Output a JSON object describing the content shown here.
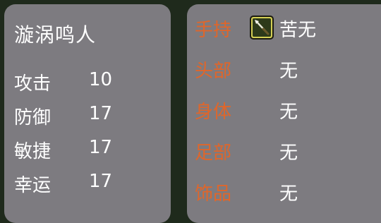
{
  "character": {
    "name": "漩涡鸣人",
    "stats": [
      {
        "label": "攻击",
        "value": "10"
      },
      {
        "label": "防御",
        "value": "17"
      },
      {
        "label": "敏捷",
        "value": "17"
      },
      {
        "label": "幸运",
        "value": "17"
      }
    ]
  },
  "equipment": {
    "slots": [
      {
        "label": "手持",
        "value": "苦无",
        "icon": "kunai-icon"
      },
      {
        "label": "头部",
        "value": "无"
      },
      {
        "label": "身体",
        "value": "无"
      },
      {
        "label": "足部",
        "value": "无"
      },
      {
        "label": "饰品",
        "value": "无"
      }
    ]
  },
  "colors": {
    "background": "#1f2a1c",
    "panel": "#7d7b80",
    "slot_label": "#e0662a",
    "text": "#ffffff",
    "icon_frame": "#b3ae2d"
  }
}
